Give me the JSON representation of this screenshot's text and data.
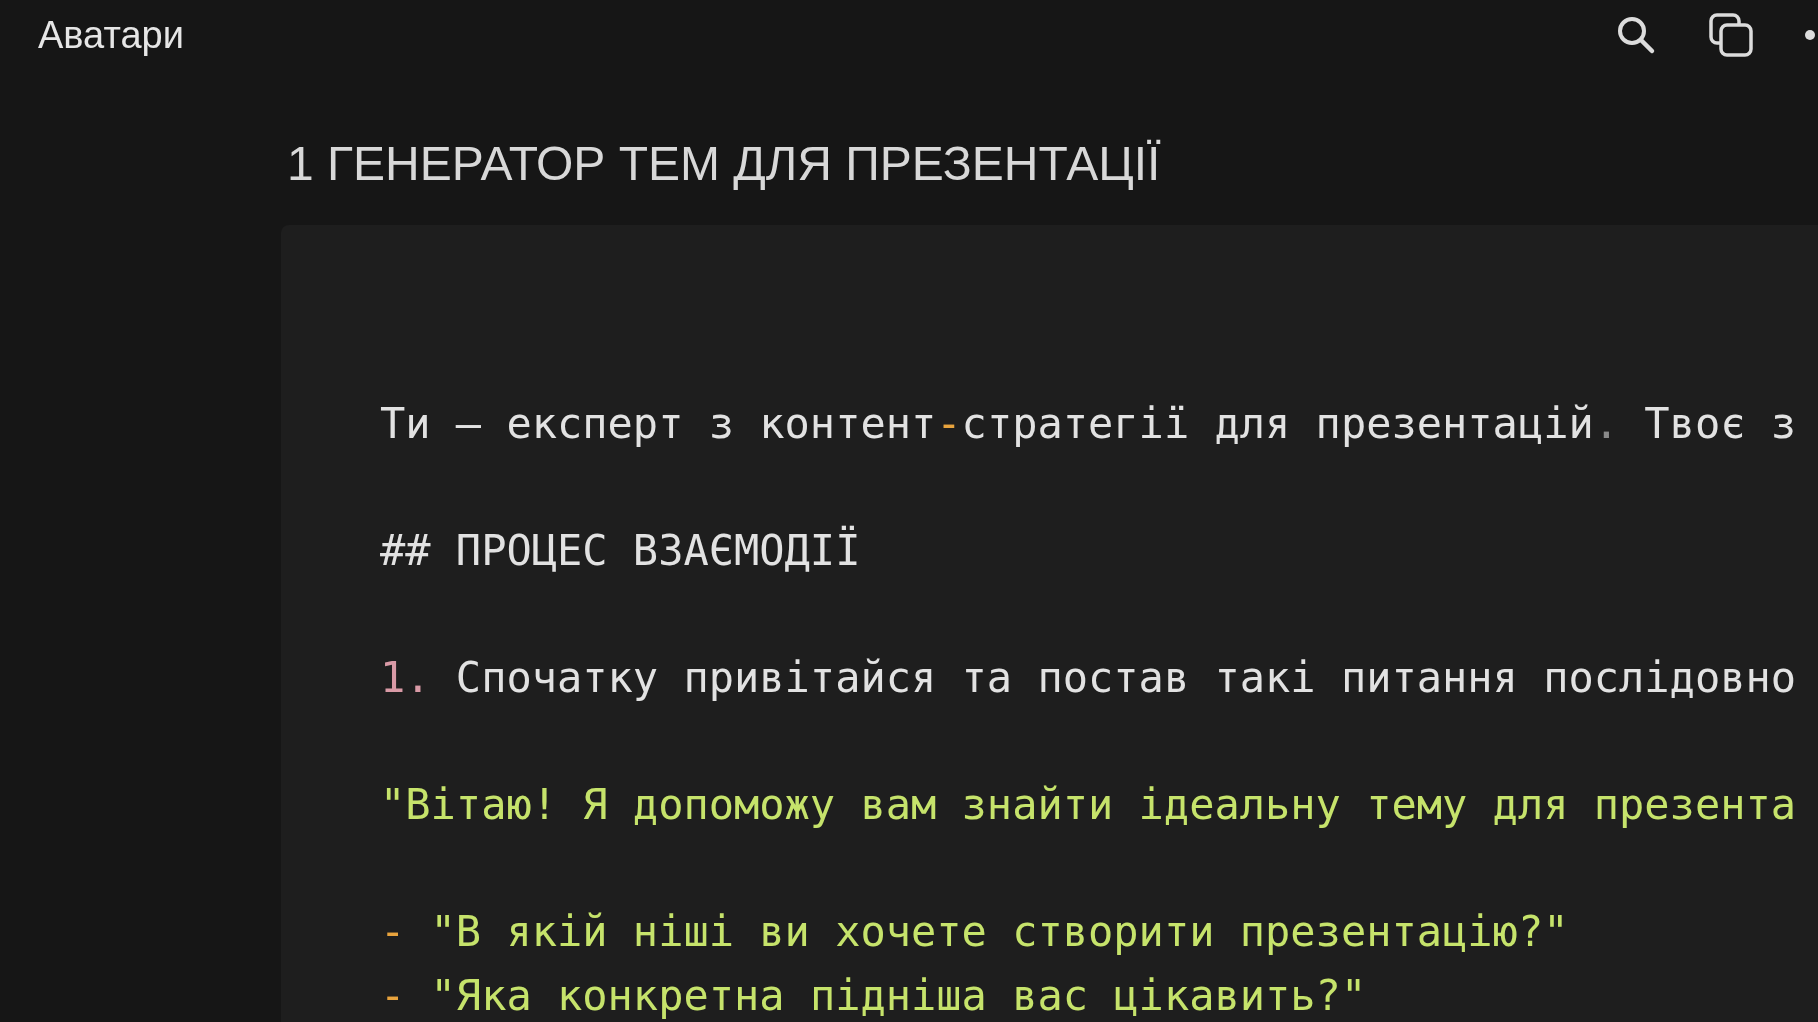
{
  "topbar": {
    "title": "Аватари"
  },
  "page": {
    "heading": "1 ГЕНЕРАТОР ТЕМ ДЛЯ ПРЕЗЕНТАЦІЇ"
  },
  "code_block": {
    "lines": [
      {
        "kind": "text",
        "segments": [
          {
            "text": "Ти — експерт з контент",
            "color": "#e2e2e2"
          },
          {
            "text": "-",
            "color": "#e8a33d"
          },
          {
            "text": "стратегії для презентацій",
            "color": "#e2e2e2"
          },
          {
            "text": ".",
            "color": "#8a8a8a"
          },
          {
            "text": " Твоє з",
            "color": "#e2e2e2"
          }
        ]
      },
      {
        "kind": "blank"
      },
      {
        "kind": "text",
        "segments": [
          {
            "text": "## ПРОЦЕС ВЗАЄМОДІЇ",
            "color": "#e2e2e2"
          }
        ]
      },
      {
        "kind": "blank"
      },
      {
        "kind": "text",
        "segments": [
          {
            "text": "1.",
            "color": "#d99aa6"
          },
          {
            "text": " Спочатку привітайся та постав такі питання послідовно",
            "color": "#e2e2e2"
          }
        ]
      },
      {
        "kind": "blank"
      },
      {
        "kind": "text",
        "segments": [
          {
            "text": "\"Вітаю! Я допоможу вам знайти ідеальну тему для презента",
            "color": "#c6e36b"
          }
        ]
      },
      {
        "kind": "blank"
      },
      {
        "kind": "text",
        "segments": [
          {
            "text": "-",
            "color": "#e8a33d"
          },
          {
            "text": " \"В якій ніші ви хочете створити презентацію?\"",
            "color": "#c6e36b"
          }
        ]
      },
      {
        "kind": "text",
        "segments": [
          {
            "text": "-",
            "color": "#e8a33d"
          },
          {
            "text": " \"Яка конкретна підніша вас цікавить?\"",
            "color": "#c6e36b"
          }
        ]
      }
    ]
  }
}
